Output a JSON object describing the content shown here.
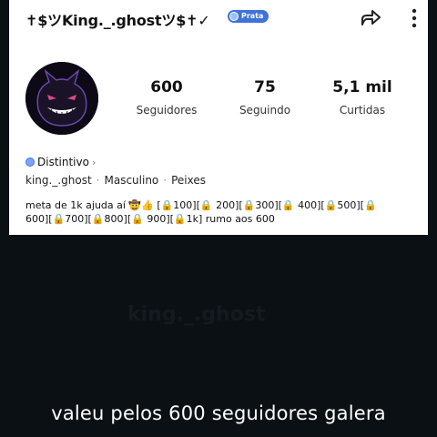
{
  "profile": {
    "username": "✝$ツKing._.ghostツ$✝✓",
    "badge_label": "Prata",
    "avatar_icon": "gengar-avatar"
  },
  "stats": [
    {
      "value": "600",
      "label": "Seguidores"
    },
    {
      "value": "75",
      "label": "Seguindo"
    },
    {
      "value": "5,1 mil",
      "label": "Curtidas"
    }
  ],
  "distintivo": {
    "label": "Distintivo",
    "chevron": "›"
  },
  "info": {
    "handle": "king._.ghost",
    "gender": "Masculino",
    "sign": "Peixes",
    "separator": "·"
  },
  "bio": {
    "line1": "meta de 1k ajuda aí 🤠👍 [🔒100][🔒 200][🔒300][🔒 400][🔒500][🔒",
    "line2": "600][🔒700][🔒800][🔒 900][🔒1k] rumo aos 600"
  },
  "overlay": {
    "faded_text": "king._.ghost"
  },
  "caption": "valeu pelos 600 seguidores galera",
  "colors": {
    "background": "#0b1014",
    "badge": "#3f73d8",
    "card": "#ffffff"
  }
}
